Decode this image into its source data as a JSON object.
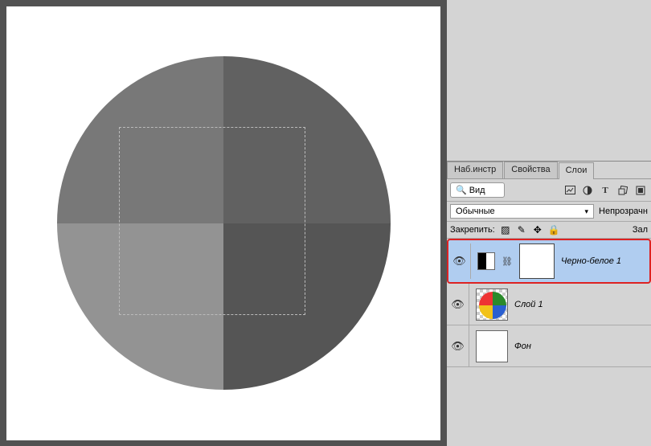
{
  "tabs": {
    "toolset": "Наб.инстр",
    "properties": "Свойства",
    "layers": "Слои"
  },
  "search": {
    "label": "Вид"
  },
  "row_icons": {
    "image": "img",
    "adjust": "adj",
    "text": "T",
    "shape": "shape",
    "smart": "smart"
  },
  "blend": {
    "mode": "Обычные",
    "opacity_label": "Непрозрачн"
  },
  "lock": {
    "label": "Закрепить:",
    "fill_label": "Зал"
  },
  "layers": [
    {
      "name": "Черно-белое 1",
      "type": "adjustment",
      "selected": true
    },
    {
      "name": "Слой 1",
      "type": "raster",
      "selected": false
    },
    {
      "name": "Фон",
      "type": "background",
      "selected": false
    }
  ]
}
